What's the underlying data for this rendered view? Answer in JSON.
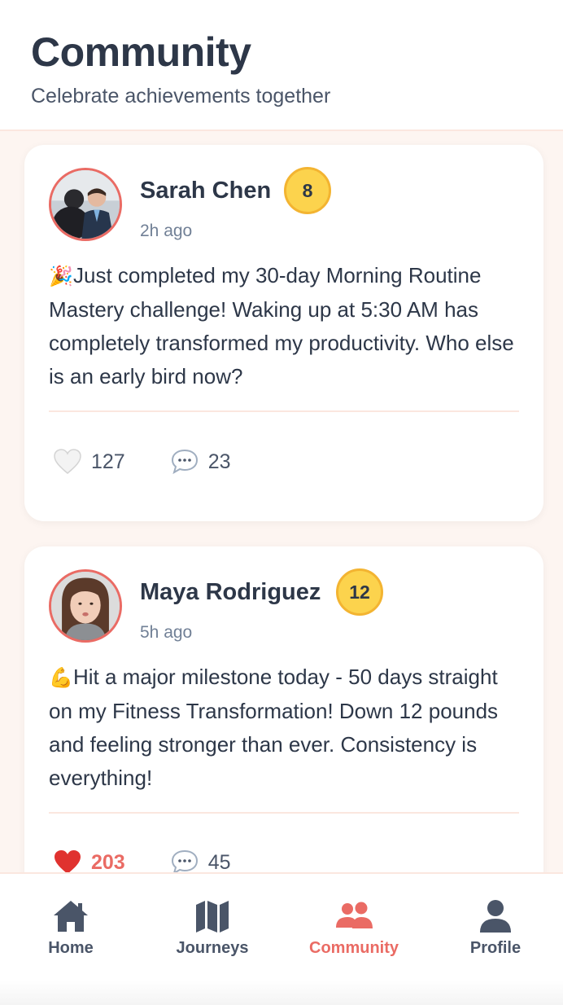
{
  "header": {
    "title": "Community",
    "subtitle": "Celebrate achievements together"
  },
  "posts": [
    {
      "author": "Sarah Chen",
      "level": "8",
      "time": "2h ago",
      "emoji": "🎉",
      "body": "Just completed my 30-day Morning Routine Mastery challenge! Waking up at 5:30 AM has completely transformed my productivity. Who else is an early bird now?",
      "likes": "127",
      "comments": "23",
      "liked": false
    },
    {
      "author": "Maya Rodriguez",
      "level": "12",
      "time": "5h ago",
      "emoji": "💪",
      "body": "Hit a major milestone today - 50 days straight on my Fitness Transformation! Down 12 pounds and feeling stronger than ever. Consistency is everything!",
      "likes": "203",
      "comments": "45",
      "liked": true
    }
  ],
  "tabbar": {
    "tabs": [
      {
        "label": "Home",
        "icon": "home-icon"
      },
      {
        "label": "Journeys",
        "icon": "map-icon"
      },
      {
        "label": "Community",
        "icon": "users-icon"
      },
      {
        "label": "Profile",
        "icon": "user-icon"
      }
    ],
    "active": "Community"
  },
  "colors": {
    "accent": "#ea6b64",
    "badge": "#fcd34d",
    "text": "#2d3748",
    "muted": "#718096",
    "background": "#fdf5f1"
  }
}
